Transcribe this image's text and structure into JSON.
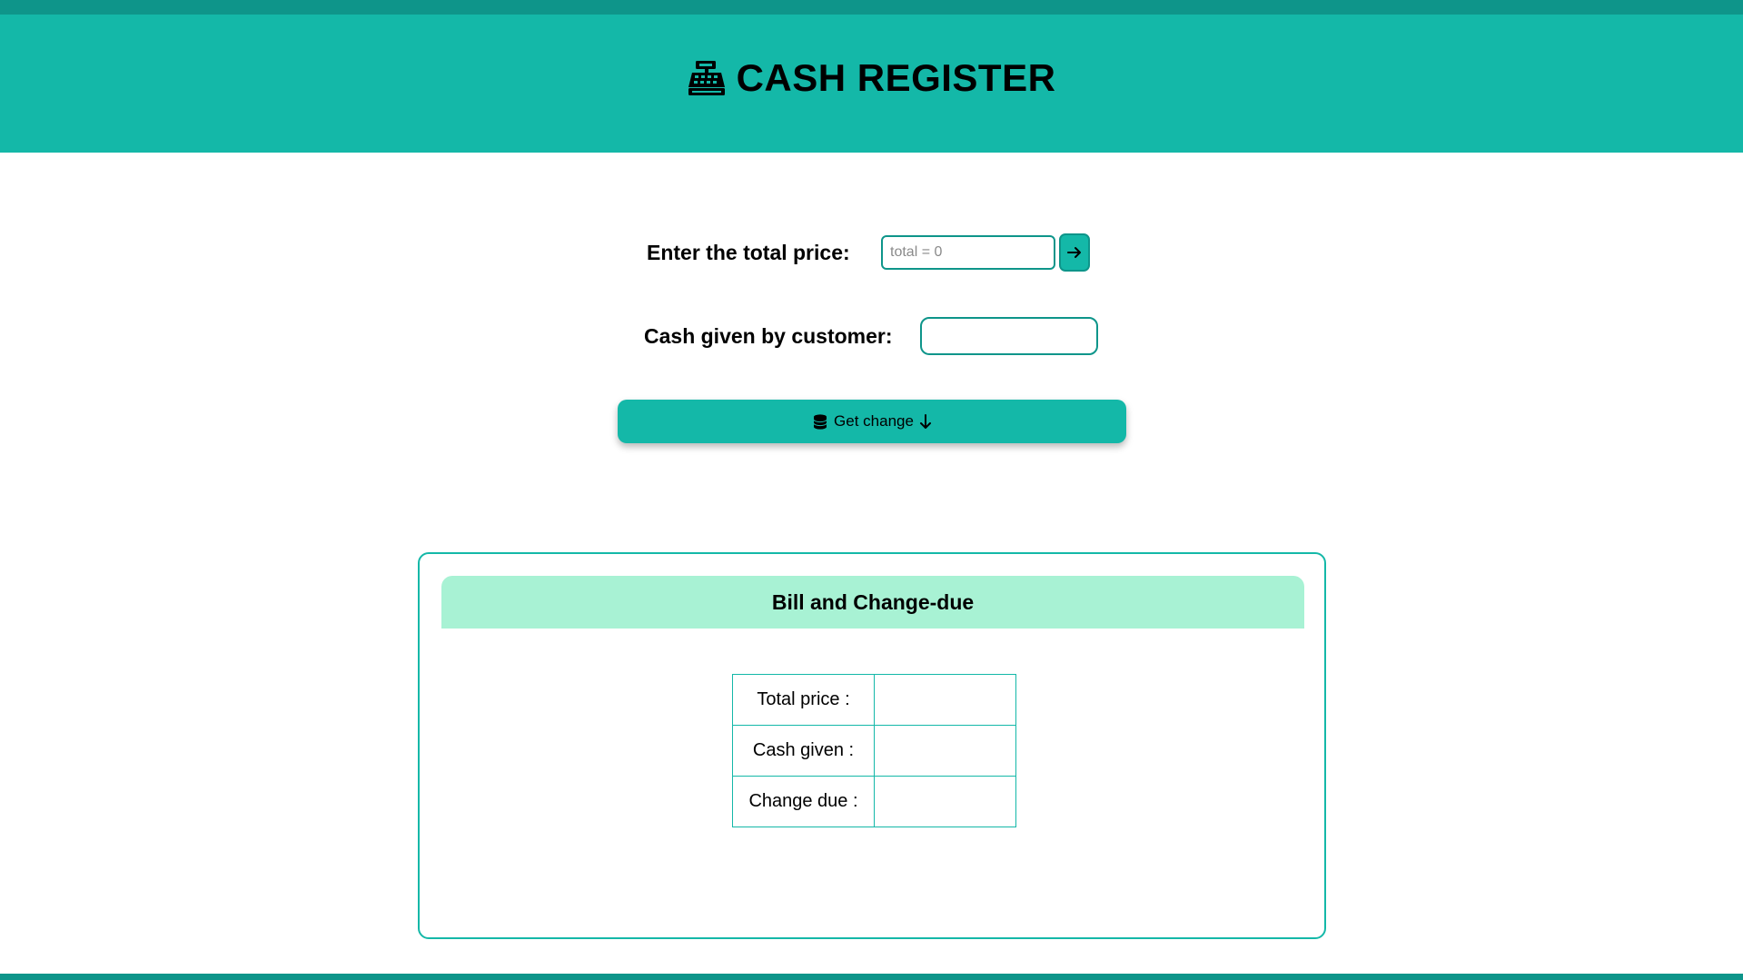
{
  "header": {
    "title": "CASH REGISTER",
    "icon": "cash-register-icon"
  },
  "form": {
    "price_label": "Enter the total price:",
    "price_placeholder": "total = 0",
    "price_value": "",
    "submit_icon": "arrow-right-icon",
    "cash_label": "Cash given by customer:",
    "cash_value": ""
  },
  "action": {
    "label": "Get change",
    "leading_icon": "coins-icon",
    "trailing_icon": "arrow-down-icon"
  },
  "bill": {
    "title": "Bill and Change-due",
    "rows": [
      {
        "label": "Total price :",
        "value": ""
      },
      {
        "label": "Cash given :",
        "value": ""
      },
      {
        "label": "Change due :",
        "value": ""
      }
    ]
  },
  "colors": {
    "header_bg": "#14b8a8",
    "header_dark": "#0e958a",
    "bill_header_bg": "#a8f2d4",
    "accent": "#14b8a8"
  }
}
